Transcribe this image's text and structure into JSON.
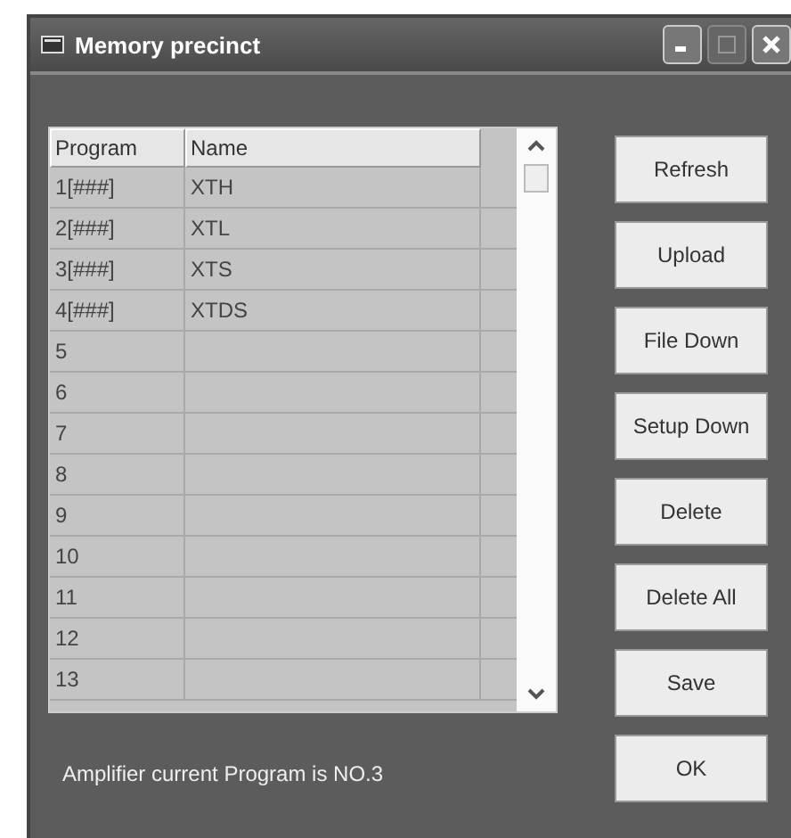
{
  "window": {
    "title": "Memory precinct"
  },
  "table": {
    "columns": [
      "Program",
      "Name"
    ],
    "rows": [
      {
        "program": "1[###]",
        "name": "XTH"
      },
      {
        "program": "2[###]",
        "name": "XTL"
      },
      {
        "program": "3[###]",
        "name": "XTS"
      },
      {
        "program": "4[###]",
        "name": "XTDS"
      },
      {
        "program": "5",
        "name": ""
      },
      {
        "program": "6",
        "name": ""
      },
      {
        "program": "7",
        "name": ""
      },
      {
        "program": "8",
        "name": ""
      },
      {
        "program": "9",
        "name": ""
      },
      {
        "program": "10",
        "name": ""
      },
      {
        "program": "11",
        "name": ""
      },
      {
        "program": "12",
        "name": ""
      },
      {
        "program": "13",
        "name": ""
      }
    ]
  },
  "buttons": [
    "Refresh",
    "Upload",
    "File Down",
    "Setup Down",
    "Delete",
    "Delete All",
    "Save",
    "OK"
  ],
  "status": "Amplifier current Program is NO.3"
}
